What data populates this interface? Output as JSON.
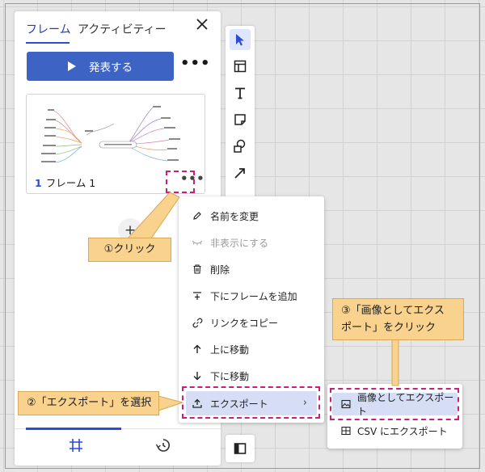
{
  "panel": {
    "tab_frame": "フレーム",
    "tab_activity": "アクティビティー",
    "present_label": "発表する",
    "frame_number": "1",
    "frame_name": "フレーム 1"
  },
  "context_menu": {
    "items": [
      {
        "label": "名前を変更",
        "icon": "pencil-icon"
      },
      {
        "label": "非表示にする",
        "icon": "eye-closed-icon"
      },
      {
        "label": "削除",
        "icon": "trash-icon"
      },
      {
        "label": "下にフレームを追加",
        "icon": "add-below-icon"
      },
      {
        "label": "リンクをコピー",
        "icon": "link-icon"
      },
      {
        "label": "上に移動",
        "icon": "arrow-up-icon"
      },
      {
        "label": "下に移動",
        "icon": "arrow-down-icon"
      },
      {
        "label": "エクスポート",
        "icon": "upload-icon"
      }
    ]
  },
  "submenu": {
    "items": [
      {
        "label": "画像としてエクスポート",
        "icon": "image-icon"
      },
      {
        "label": "CSV にエクスポート",
        "icon": "table-icon"
      }
    ]
  },
  "callouts": {
    "step1": "①クリック",
    "step2": "②「エクスポート」を選択",
    "step3_line1": "③「画像としてエクス",
    "step3_line2": "ポート」をクリック"
  },
  "colors": {
    "accent": "#3d63c4",
    "highlight": "#d5def5",
    "callout": "#f9d28e",
    "dashed_marker": "#c91f7a"
  }
}
